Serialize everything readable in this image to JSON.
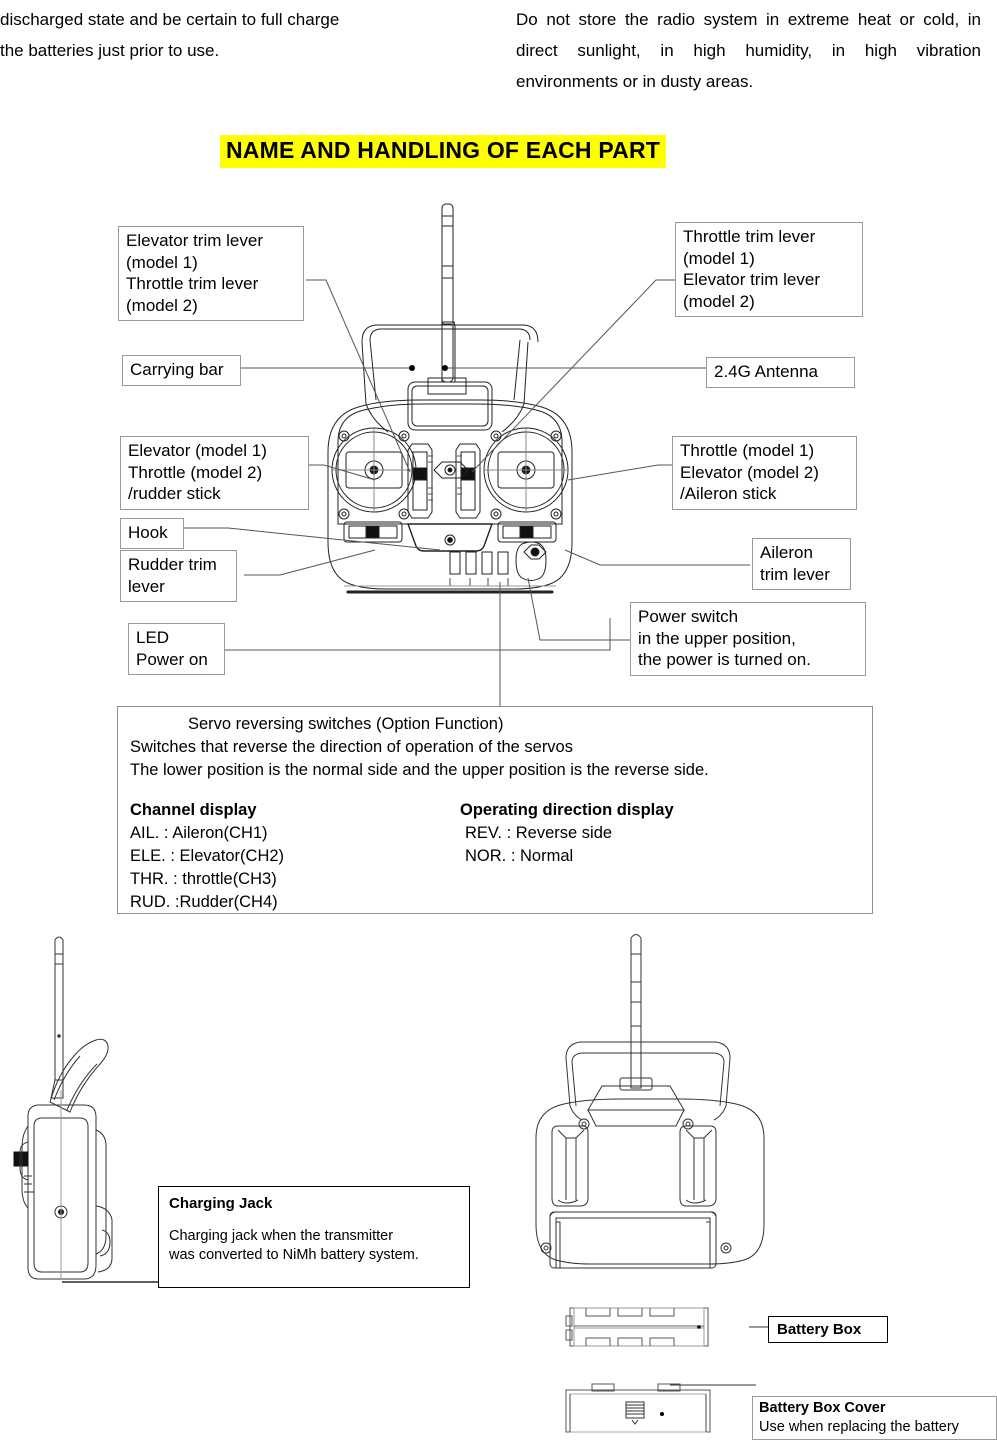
{
  "page": {
    "intro_left": "discharged state and be certain to full charge",
    "intro_left2": "the batteries just prior to use.",
    "intro_right": "Do not store the radio system in extreme heat or cold, in direct sunlight, in high humidity, in high vibration environments or in dusty areas.",
    "section_title": "NAME AND HANDLING OF EACH PART",
    "highlight_color": "#ffff00"
  },
  "callouts": {
    "elevator_trim_left": "Elevator trim lever\n(model 1)\nThrottle trim lever\n(model 2)",
    "carrying_bar": "Carrying bar",
    "throttle_trim_right": "Throttle trim lever\n(model 1)\nElevator trim lever\n(model 2)",
    "antenna": "2.4G Antenna",
    "left_stick": "Elevator (model 1)\nThrottle (model 2)\n/rudder stick",
    "hook": "Hook",
    "rudder_trim": "Rudder trim\nlever",
    "led": "LED\nPower on",
    "right_stick": "Throttle (model 1)\nElevator (model 2)\n/Aileron stick",
    "aileron_trim": "Aileron\ntrim lever",
    "power_switch": "Power switch\nin the upper position,\nthe power is turned on."
  },
  "servo_box": {
    "heading": "Servo reversing switches (Option Function)",
    "line1": "Switches that reverse the direction of operation of the servos",
    "line2": "The lower position is the normal side and the upper position is the reverse side.",
    "channel_heading": "Channel display",
    "direction_heading": "Operating direction display",
    "channels": [
      "AIL. : Aileron(CH1)",
      "ELE. : Elevator(CH2)",
      "THR. : throttle(CH3)",
      "RUD. :Rudder(CH4)"
    ],
    "directions": [
      "REV. : Reverse side",
      "NOR. : Normal"
    ]
  },
  "bottom": {
    "charging_jack_title": "Charging Jack",
    "charging_jack_body": "Charging jack when the transmitter\nwas converted to NiMh battery system.",
    "battery_box": "Battery Box",
    "battery_cover_title": "Battery Box Cover",
    "battery_cover_body": "Use when replacing the battery"
  }
}
